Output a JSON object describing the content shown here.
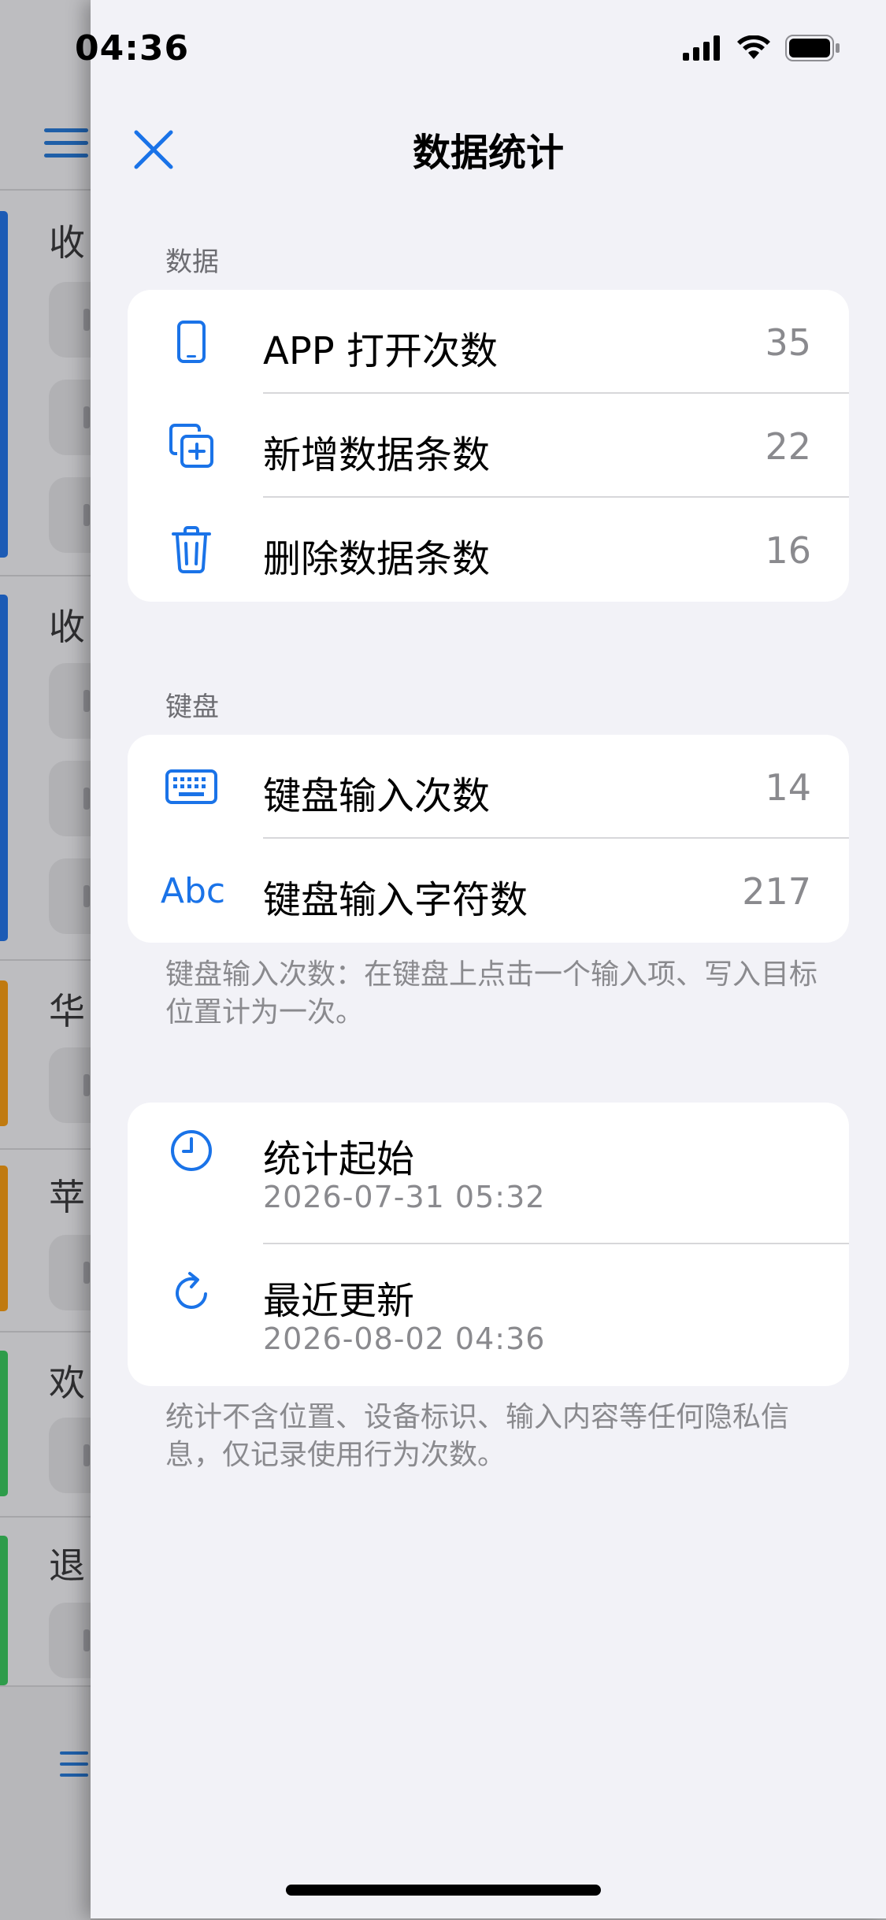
{
  "status_bar": {
    "time": "04:36"
  },
  "background_app": {
    "fragments": [
      "收",
      "收",
      "华",
      "苹",
      "欢",
      "退"
    ]
  },
  "sheet": {
    "title": "数据统计",
    "sections": {
      "data": {
        "header": "数据",
        "rows": [
          {
            "icon": "phone-icon",
            "label": "APP 打开次数",
            "value": "35"
          },
          {
            "icon": "add-copy-icon",
            "label": "新增数据条数",
            "value": "22"
          },
          {
            "icon": "trash-icon",
            "label": "删除数据条数",
            "value": "16"
          }
        ]
      },
      "keyboard": {
        "header": "键盘",
        "rows": [
          {
            "icon": "keyboard-icon",
            "label": "键盘输入次数",
            "value": "14"
          },
          {
            "icon": "abc-icon",
            "icon_text": "Abc",
            "label": "键盘输入字符数",
            "value": "217"
          }
        ],
        "footnote": "键盘输入次数：在键盘上点击一个输入项、写入目标位置计为一次。"
      },
      "time": {
        "rows": [
          {
            "icon": "clock-icon",
            "label": "统计起始",
            "value": "2026-07-31 05:32"
          },
          {
            "icon": "refresh-icon",
            "label": "最近更新",
            "value": "2026-08-02 04:36"
          }
        ],
        "footnote": "统计不含位置、设备标识、输入内容等任何隐私信息，仅记录使用行为次数。"
      }
    }
  },
  "colors": {
    "accent": "#1a73e8",
    "background": "#f2f2f7",
    "card": "#ffffff",
    "secondary_text": "#8a8a8e"
  }
}
